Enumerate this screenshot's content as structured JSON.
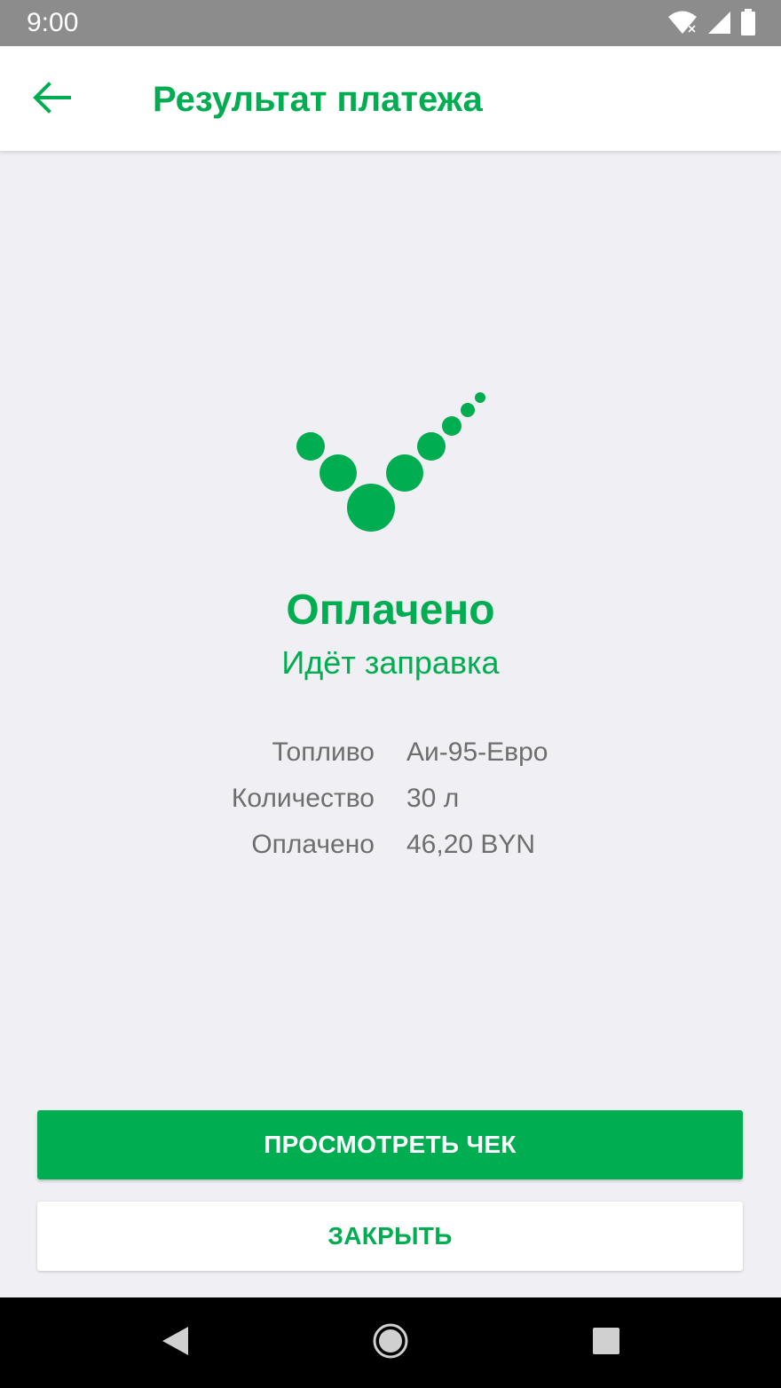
{
  "status_bar": {
    "time": "9:00",
    "icons": [
      "wifi-icon",
      "cellular-icon",
      "battery-icon"
    ]
  },
  "app_bar": {
    "title": "Результат платежа",
    "back_icon": "arrow-back-icon"
  },
  "result": {
    "icon": "success-check-icon",
    "title": "Оплачено",
    "subtitle": "Идёт заправка"
  },
  "details": [
    {
      "label": "Топливо",
      "value": "Аи-95-Евро"
    },
    {
      "label": "Количество",
      "value": "30 л"
    },
    {
      "label": "Оплачено",
      "value": "46,20 BYN"
    }
  ],
  "buttons": {
    "view_receipt": "ПРОСМОТРЕТЬ ЧЕК",
    "close": "ЗАКРЫТЬ"
  },
  "colors": {
    "accent": "#00ad50",
    "background": "#efeff4",
    "status_bar": "#8c8c8c"
  }
}
